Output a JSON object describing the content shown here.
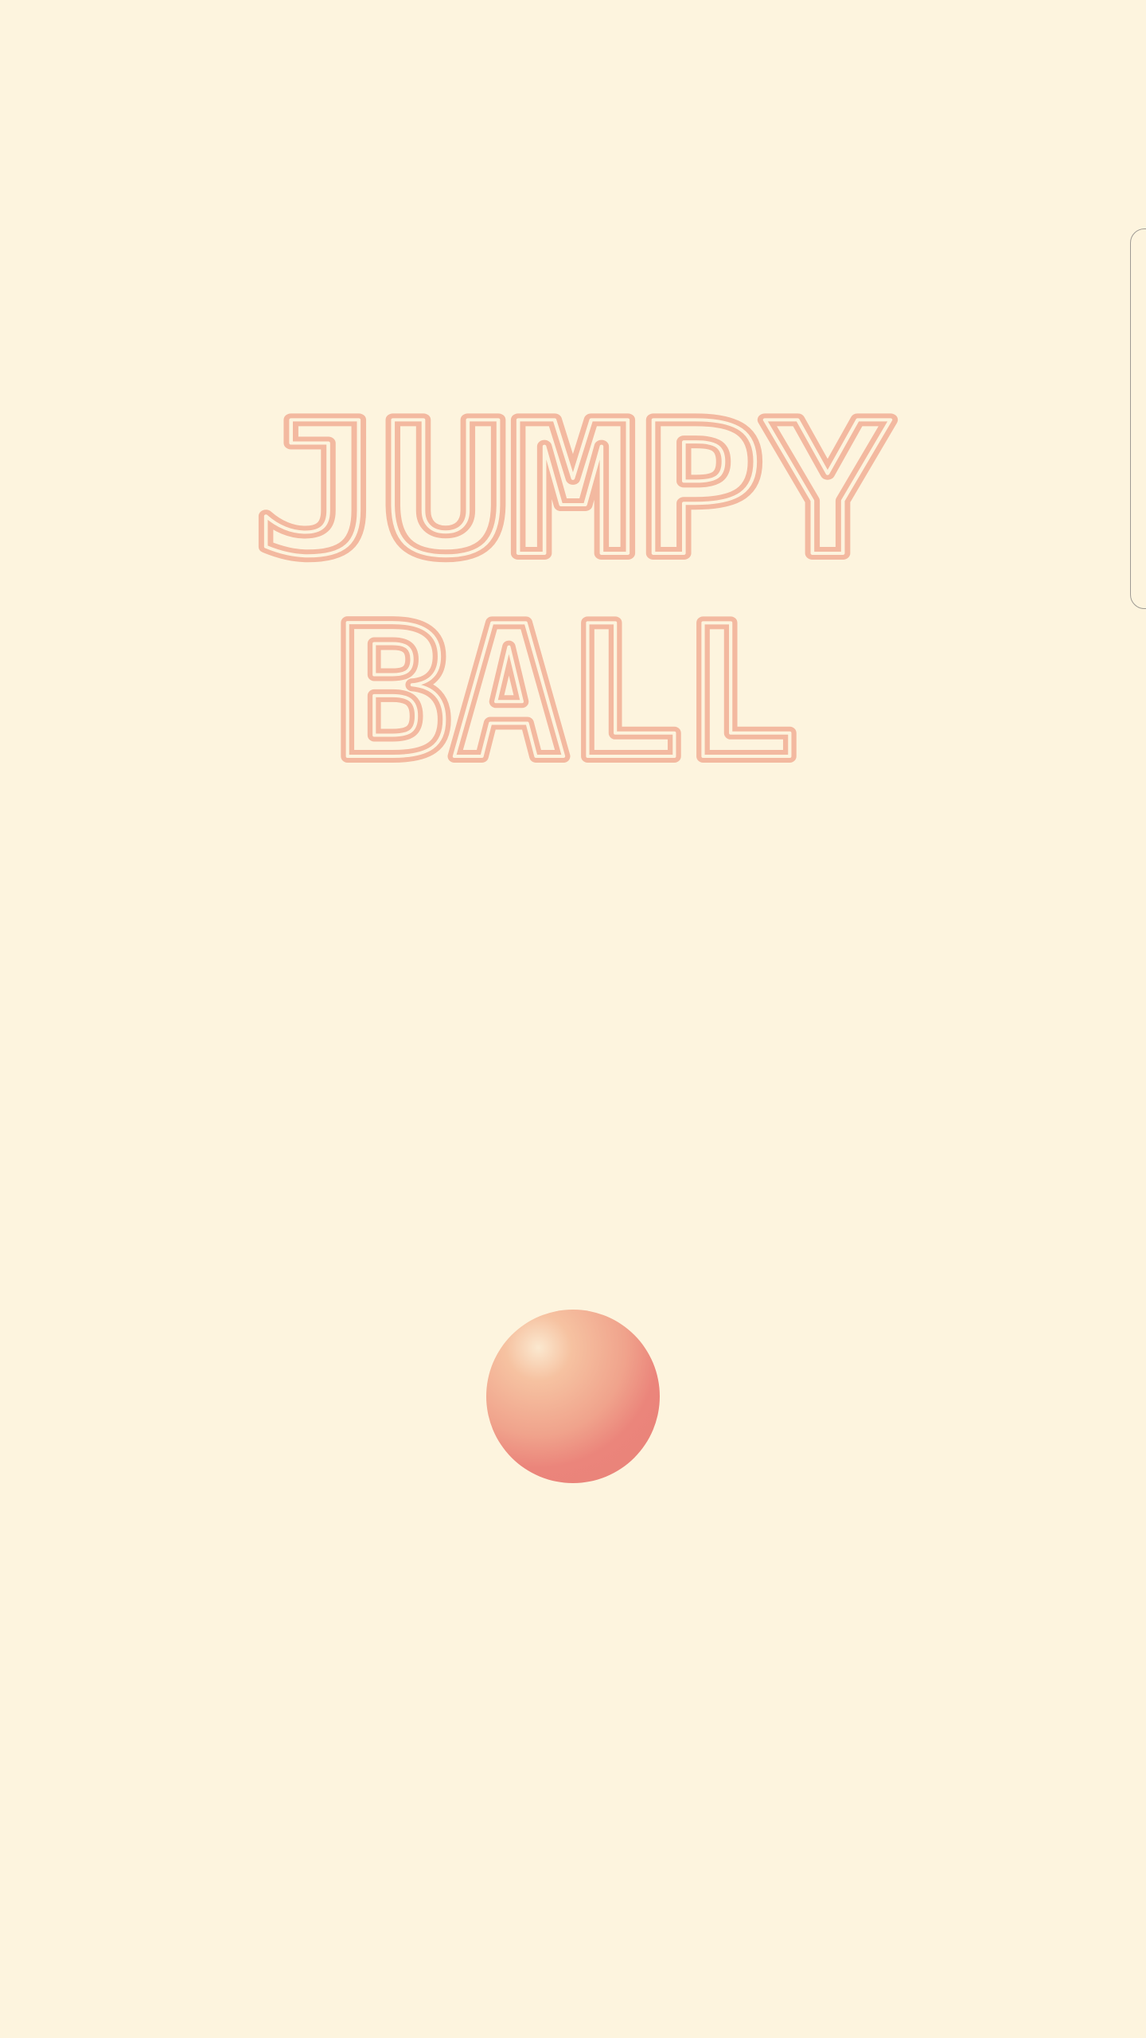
{
  "game": {
    "title_line_1": "JUMPY",
    "title_line_2": "BALL"
  },
  "colors": {
    "background": "#fdf4de",
    "title_outline": "#f3b9a0",
    "ball_highlight": "#fbe8cf",
    "ball_base": "#e98279",
    "panel_border": "#9e9a94"
  },
  "icons": {
    "ball": "ball-icon"
  }
}
